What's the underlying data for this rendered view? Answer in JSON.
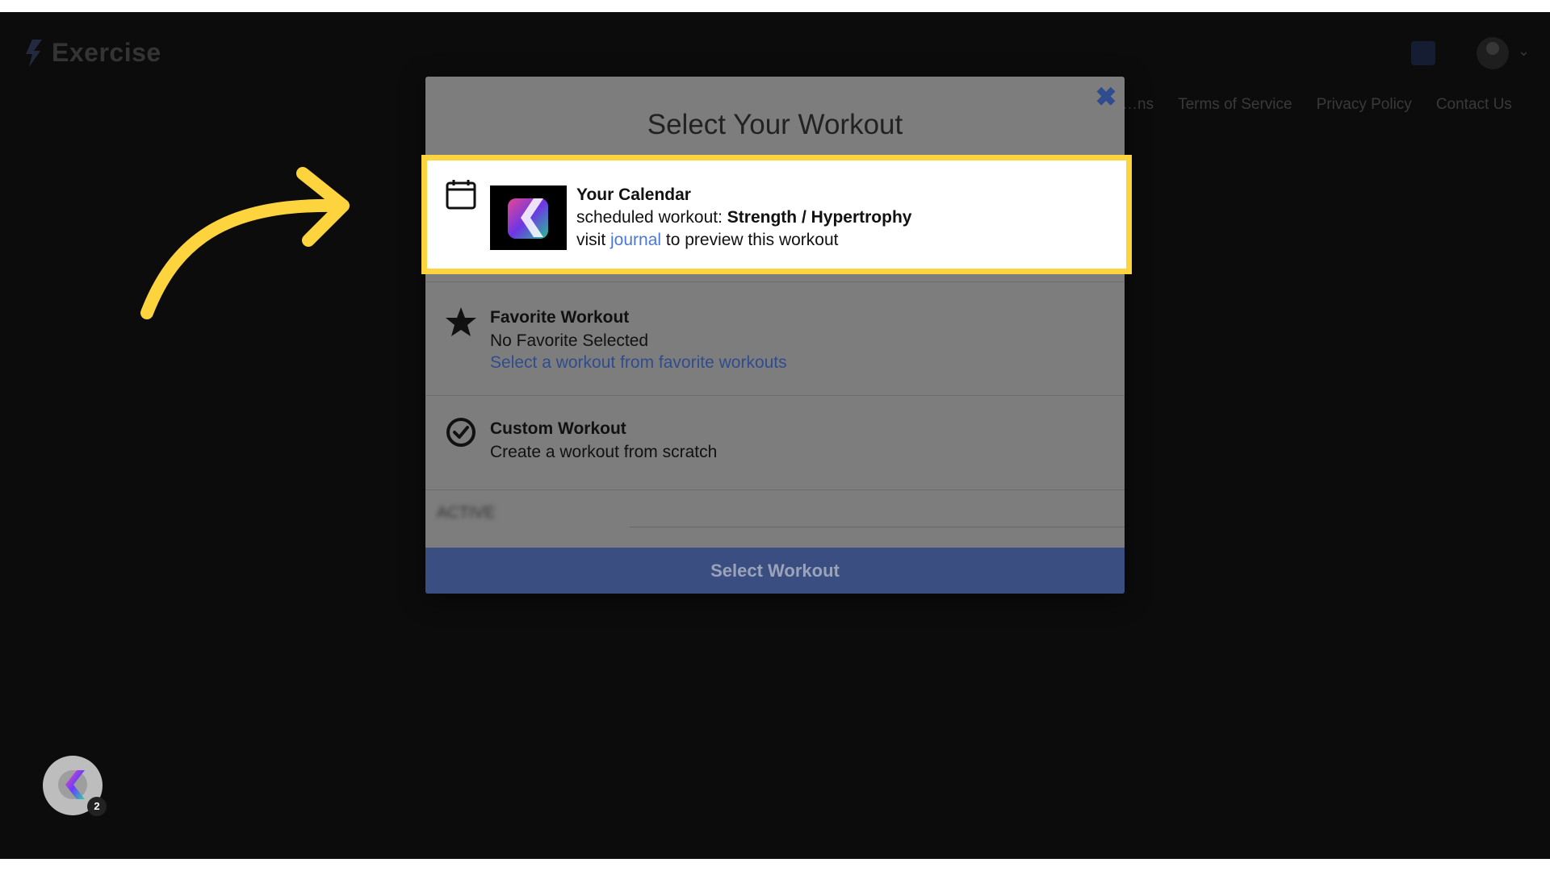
{
  "app": {
    "name": "Exercise"
  },
  "background_nav": {
    "links": [
      "…ns",
      "Terms of Service",
      "Privacy Policy",
      "Contact Us"
    ]
  },
  "modal": {
    "title": "Select Your Workout",
    "close_label": "✖",
    "options": {
      "calendar": {
        "icon": "calendar-icon",
        "heading": "Your Calendar",
        "scheduled_prefix": "scheduled workout: ",
        "scheduled_name": "Strength / Hypertrophy",
        "visit_prefix": "visit ",
        "journal_link": "journal",
        "visit_suffix": " to preview this workout"
      },
      "favorite": {
        "icon": "star-icon",
        "heading": "Favorite Workout",
        "status": "No Favorite Selected",
        "link": "Select a workout from favorite workouts"
      },
      "custom": {
        "icon": "check-circle-icon",
        "heading": "Custom Workout",
        "description": "Create a workout from scratch"
      }
    },
    "blurred_field_label": "ACTIVE",
    "select_button": "Select Workout"
  },
  "fab": {
    "badge_count": "2",
    "icon": "app-logo-icon"
  },
  "colors": {
    "highlight": "#fdd33e",
    "arrow": "#fdd33e",
    "link": "#4b78d6",
    "button": "#3b4e82"
  }
}
